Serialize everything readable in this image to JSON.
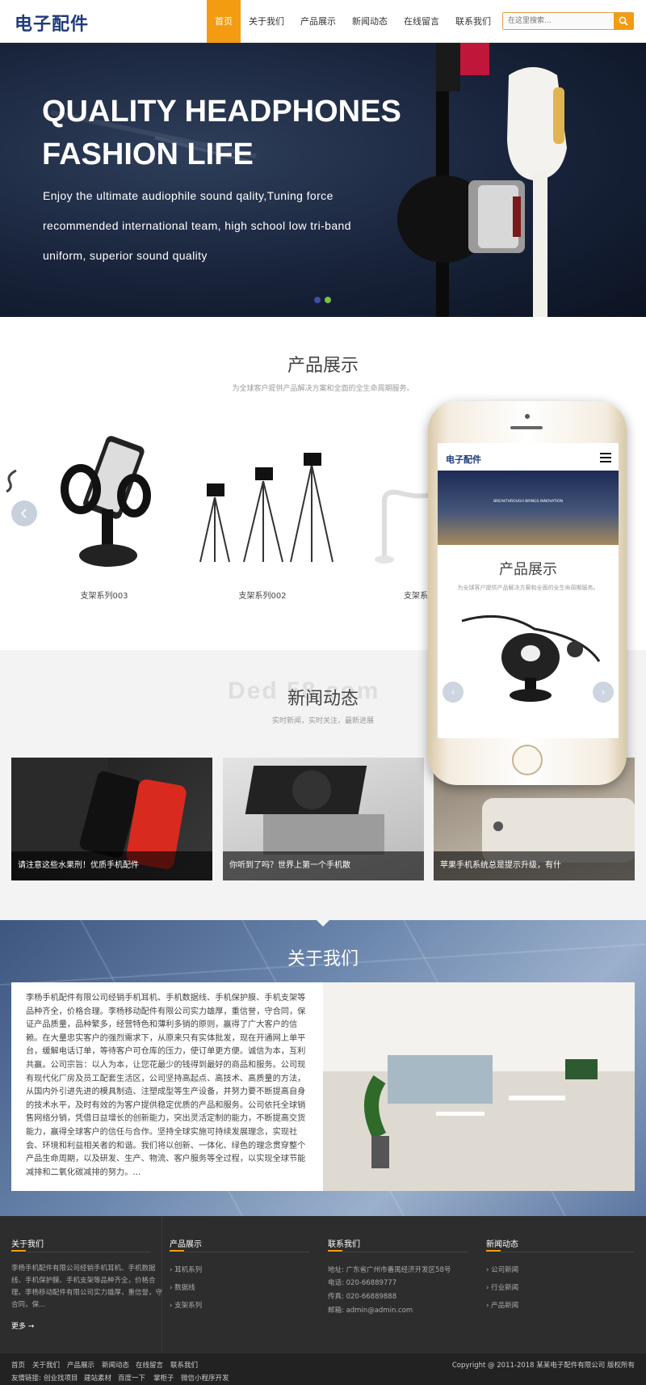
{
  "header": {
    "logo": "电子配件",
    "nav": [
      "首页",
      "关于我们",
      "产品展示",
      "新闻动态",
      "在线留言",
      "联系我们"
    ],
    "search_placeholder": "在这里搜索..."
  },
  "banner": {
    "title_line1": "QUALITY HEADPHONES",
    "title_line2": "FASHION LIFE",
    "desc_line1": "Enjoy the ultimate audiophile sound qality,Tuning force",
    "desc_line2": "recommended international team, high school low tri-band",
    "desc_line3": "uniform, superior sound quality"
  },
  "products": {
    "title": "产品展示",
    "subtitle": "为全球客户提供产品解决方案和全面的全生命周期服务。",
    "items": [
      "支架系列003",
      "支架系列002",
      "支架系"
    ]
  },
  "news": {
    "title": "新闻动态",
    "subtitle": "实时新闻，实时关注，最新进展",
    "watermark": "Ded 58.com",
    "items": [
      "请注意这些水果刑！优质手机配件",
      "你听到了吗？世界上第一个手机散",
      "苹果手机系统总是提示升级，有什"
    ]
  },
  "about": {
    "title": "关于我们",
    "text": "李杨手机配件有限公司经销手机耳机、手机数据线、手机保护膜、手机支架等品种齐全，价格合理。李杨移动配件有限公司实力雄厚，重信誉，守合同，保证产品质量，品种繁多，经营特色和薄利多销的原则，赢得了广大客户的信赖。在大量忠实客户的强烈需求下，从原来只有实体批发，现在开通网上单平台，缓解电话订单，等待客户可仓库的压力，使订单更方便。诚信为本，互利共赢。公司宗旨：以人为本，让您花最少的钱得到最好的商品和服务。公司现有现代化厂房及员工配套生活区，公司坚持高起点、高技术、高质量的方法，从国内外引进先进的模具制造、注塑成型等生产设备，并努力要不断提高自身的技术水平，及时有效的为客户提供稳定优质的产品和服务。公司依托全球销售网络分销，凭借日益增长的创新能力，突出灵活定制的能力，不断提高交货能力，赢得全球客户的信任与合作。坚持全球实施可持续发展理念，实现社会、环境和利益相关者的和谐。我们将以创新、一体化、绿色的理念贯穿整个产品生命周期，以及研发、生产、物流、客户服务等全过程，以实现全球节能减排和二氧化碳减排的努力。..."
  },
  "phone": {
    "logo": "电子配件",
    "banner_text": "BREAKTHROUGH BRINGS INNOVATION",
    "title": "产品展示",
    "subtitle": "为全球客户提供产品解决方案和全面的全生命周期服务。"
  },
  "footer": {
    "about_title": "关于我们",
    "about_text_1": "李杨手机配件有限公司经销手机耳机、手机数据",
    "about_text_2": "线、手机保护膜、手机支架等品种齐全，价格合",
    "about_text_3": "理。李杨移动配件有限公司实力雄厚，重信誉，守",
    "about_text_4": "合同，保...",
    "more": "更多 ➞",
    "products_title": "产品展示",
    "products_links": [
      "耳机系列",
      "数据线",
      "支架系列"
    ],
    "contact_title": "联系我们",
    "contact_lines": [
      "地址: 广东省广州市番禺经济开发区58号",
      "电话: 020-66889777",
      "传真: 020-66889888",
      "邮箱: admin@admin.com"
    ],
    "news_title": "新闻动态",
    "news_links": [
      "公司新闻",
      "行业新闻",
      "产品新闻"
    ]
  },
  "bottom": {
    "links": [
      "首页",
      "关于我们",
      "产品展示",
      "新闻动态",
      "在线留言",
      "联系我们"
    ],
    "copyright": "Copyright @ 2011-2018 某某电子配件有限公司 版权所有",
    "friend_label": "友情链接:",
    "friend_links": [
      "创业找项目",
      "建站素材",
      "百度一下",
      "掌柜子",
      "微信小程序开发"
    ]
  },
  "colors": {
    "accent": "#f39c12",
    "brand": "#1f3b7a",
    "footer": "#2d2d2d"
  }
}
